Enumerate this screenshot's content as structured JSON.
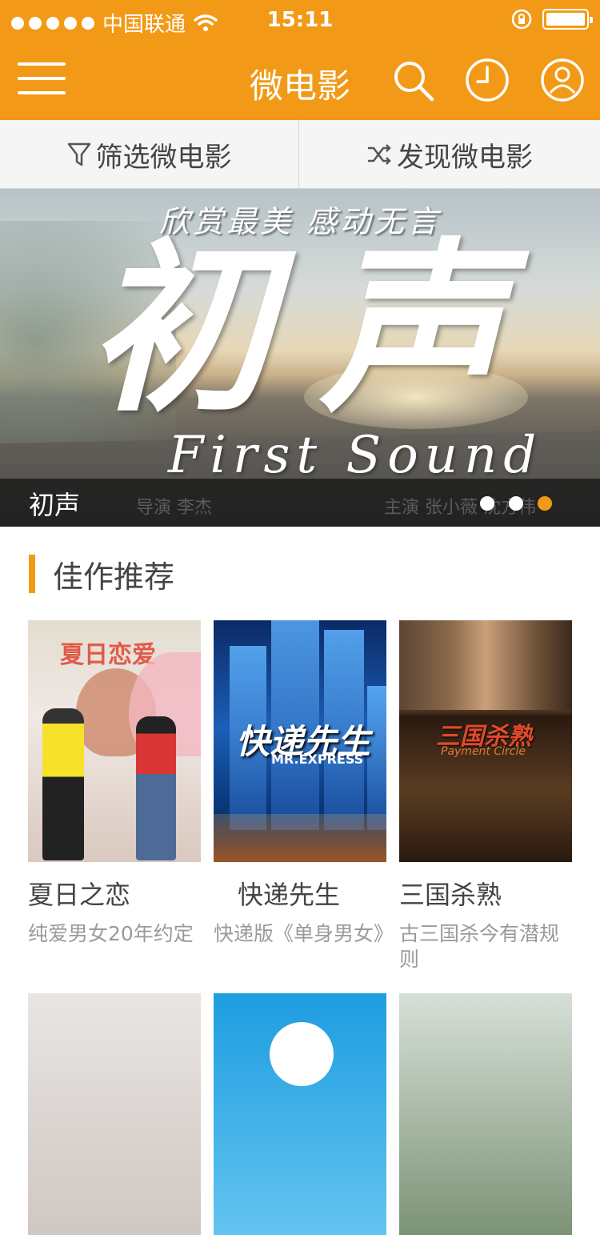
{
  "status_bar": {
    "carrier": "中国联通",
    "time": "15:11"
  },
  "nav": {
    "title": "微电影",
    "icons": [
      "menu-icon",
      "search-icon",
      "clock-icon",
      "user-icon"
    ]
  },
  "segments": {
    "filter_label": "筛选微电影",
    "discover_label": "发现微电影"
  },
  "banner": {
    "slogan": "欣赏最美  感动无言",
    "big_title": "初声",
    "english_title": "First Sound",
    "caption": "初声",
    "credit_director": "导演 李杰",
    "credit_cast": "主演 张小薇  沈方伟",
    "page_count": 3,
    "active_page": 3
  },
  "section": {
    "title": "佳作推荐"
  },
  "cards": [
    {
      "name": "夏日之恋",
      "desc": "纯爱男女20年约定",
      "poster_title": "夏日恋爱"
    },
    {
      "name": "快递先生",
      "desc": "快递版《单身男女》",
      "poster_title": "快递先生",
      "poster_sub": "MR.EXPRESS"
    },
    {
      "name": "三国杀熟",
      "desc": "古三国杀今有潜规则",
      "poster_title": "三国杀熟",
      "poster_sub": "Payment Circle"
    }
  ],
  "colors": {
    "accent": "#f29a17",
    "text": "#444444",
    "muted": "#9a9a9a"
  }
}
